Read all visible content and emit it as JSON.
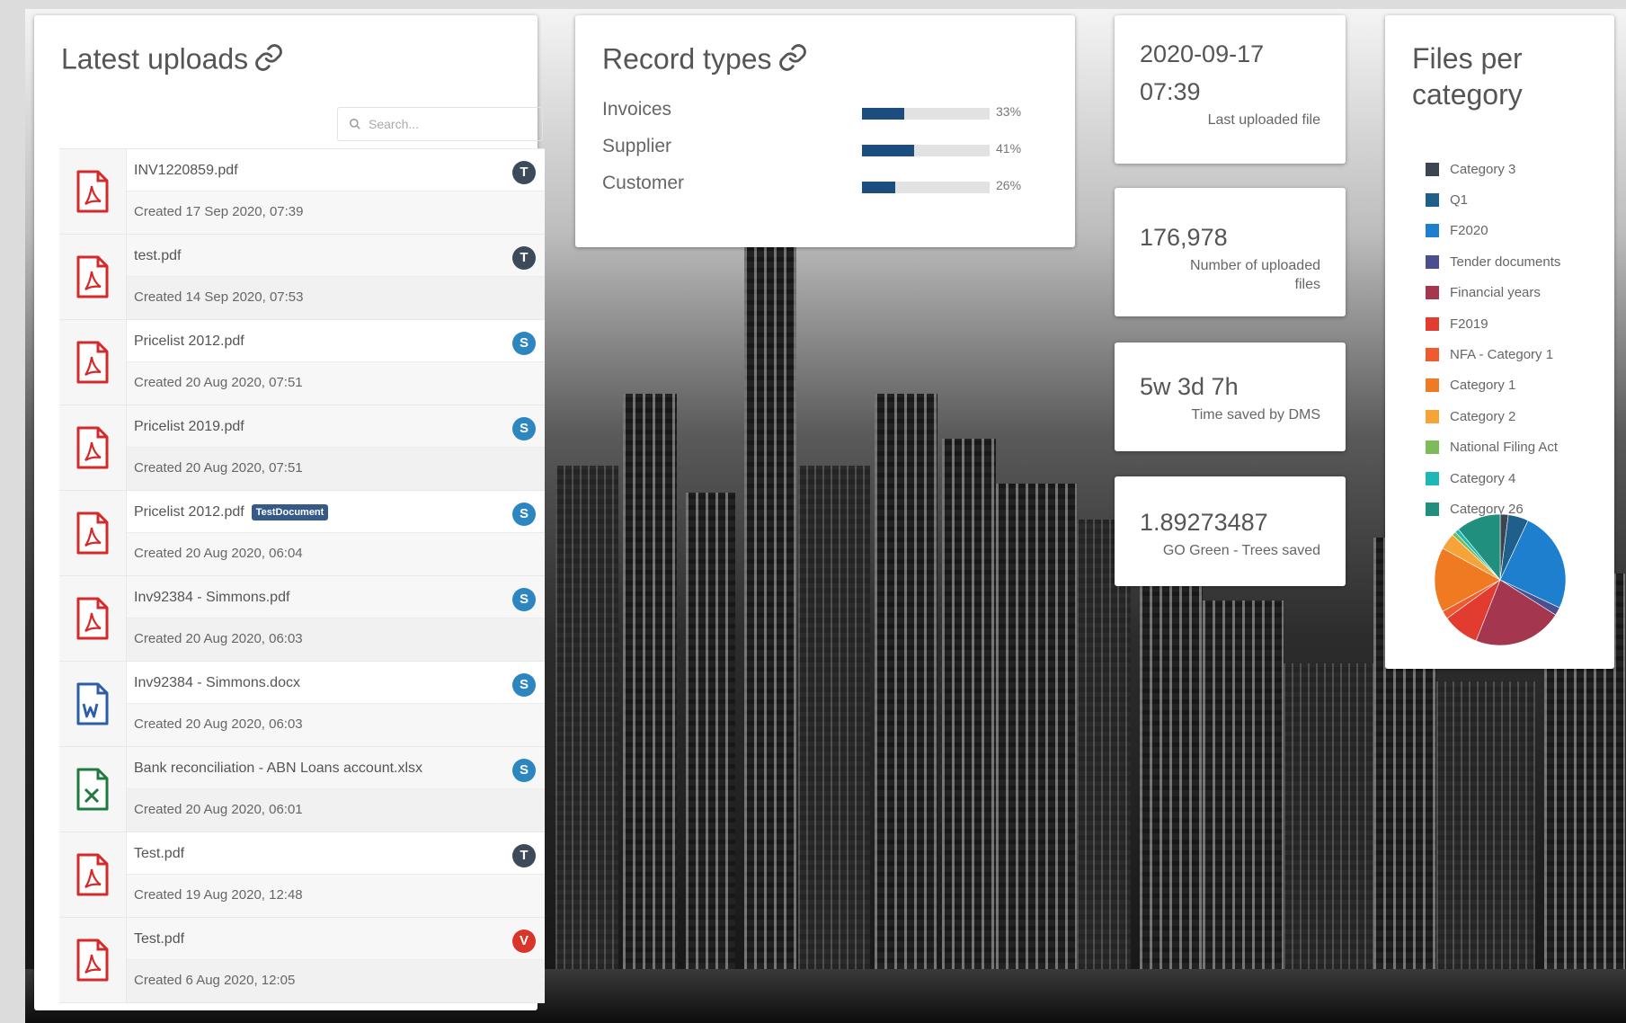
{
  "latest_uploads": {
    "title": "Latest uploads",
    "search_placeholder": "Search...",
    "items": [
      {
        "name": "INV1220859.pdf",
        "created": "Created 17 Sep 2020, 07:39",
        "type": "pdf",
        "badge": "T",
        "badge_color": "#3c4a5a",
        "tag": ""
      },
      {
        "name": "test.pdf",
        "created": "Created 14 Sep 2020, 07:53",
        "type": "pdf",
        "badge": "T",
        "badge_color": "#3c4a5a",
        "tag": ""
      },
      {
        "name": "Pricelist 2012.pdf",
        "created": "Created 20 Aug 2020, 07:51",
        "type": "pdf",
        "badge": "S",
        "badge_color": "#2e86c1",
        "tag": ""
      },
      {
        "name": "Pricelist 2019.pdf",
        "created": "Created 20 Aug 2020, 07:51",
        "type": "pdf",
        "badge": "S",
        "badge_color": "#2e86c1",
        "tag": ""
      },
      {
        "name": "Pricelist 2012.pdf",
        "created": "Created 20 Aug 2020, 06:04",
        "type": "pdf",
        "badge": "S",
        "badge_color": "#2e86c1",
        "tag": "TestDocument"
      },
      {
        "name": "Inv92384 - Simmons.pdf",
        "created": "Created 20 Aug 2020, 06:03",
        "type": "pdf",
        "badge": "S",
        "badge_color": "#2e86c1",
        "tag": ""
      },
      {
        "name": "Inv92384 - Simmons.docx",
        "created": "Created 20 Aug 2020, 06:03",
        "type": "word",
        "badge": "S",
        "badge_color": "#2e86c1",
        "tag": ""
      },
      {
        "name": "Bank reconciliation - ABN Loans account.xlsx",
        "created": "Created 20 Aug 2020, 06:01",
        "type": "excel",
        "badge": "S",
        "badge_color": "#2e86c1",
        "tag": ""
      },
      {
        "name": "Test.pdf",
        "created": "Created 19 Aug 2020, 12:48",
        "type": "pdf",
        "badge": "T",
        "badge_color": "#3c4a5a",
        "tag": ""
      },
      {
        "name": "Test.pdf",
        "created": "Created 6 Aug 2020, 12:05",
        "type": "pdf",
        "badge": "V",
        "badge_color": "#d9352b",
        "tag": ""
      }
    ]
  },
  "record_types": {
    "title": "Record types",
    "items": [
      {
        "label": "Invoices",
        "percent": 33,
        "percent_label": "33%"
      },
      {
        "label": "Supplier",
        "percent": 41,
        "percent_label": "41%"
      },
      {
        "label": "Customer",
        "percent": 26,
        "percent_label": "26%"
      }
    ]
  },
  "stats": [
    {
      "value": "2020-09-17 07:39",
      "label": "Last uploaded file"
    },
    {
      "value": "176,978",
      "label": "Number of uploaded files"
    },
    {
      "value": "5w 3d 7h",
      "label": "Time saved by DMS"
    },
    {
      "value": "1.89273487",
      "label": "GO Green - Trees saved"
    }
  ],
  "files_per_category": {
    "title": "Files per category",
    "legend": [
      {
        "label": "Category 3",
        "color": "#3b4652"
      },
      {
        "label": "Q1",
        "color": "#1f5f8b"
      },
      {
        "label": "F2020",
        "color": "#1d7fcd"
      },
      {
        "label": "Tender documents",
        "color": "#4a4f8f"
      },
      {
        "label": "Financial years",
        "color": "#a4374f"
      },
      {
        "label": "F2019",
        "color": "#e23b2f"
      },
      {
        "label": "NFA - Category 1",
        "color": "#ef5a2f"
      },
      {
        "label": "Category 1",
        "color": "#f07a22"
      },
      {
        "label": "Category 2",
        "color": "#f6a33a"
      },
      {
        "label": "National Filing Act",
        "color": "#7dbb5a"
      },
      {
        "label": "Category 4",
        "color": "#1db8b5"
      },
      {
        "label": "Category 26",
        "color": "#218f7e"
      }
    ],
    "pie": [
      {
        "label": "Category 3",
        "share": 2
      },
      {
        "label": "Q1",
        "share": 5
      },
      {
        "label": "F2020",
        "share": 25
      },
      {
        "label": "Tender documents",
        "share": 2
      },
      {
        "label": "Financial years",
        "share": 22
      },
      {
        "label": "F2019",
        "share": 9
      },
      {
        "label": "NFA - Category 1",
        "share": 2
      },
      {
        "label": "Category 1",
        "share": 16
      },
      {
        "label": "Category 2",
        "share": 4
      },
      {
        "label": "National Filing Act",
        "share": 1
      },
      {
        "label": "Category 4",
        "share": 1
      },
      {
        "label": "Category 26",
        "share": 11
      }
    ]
  }
}
